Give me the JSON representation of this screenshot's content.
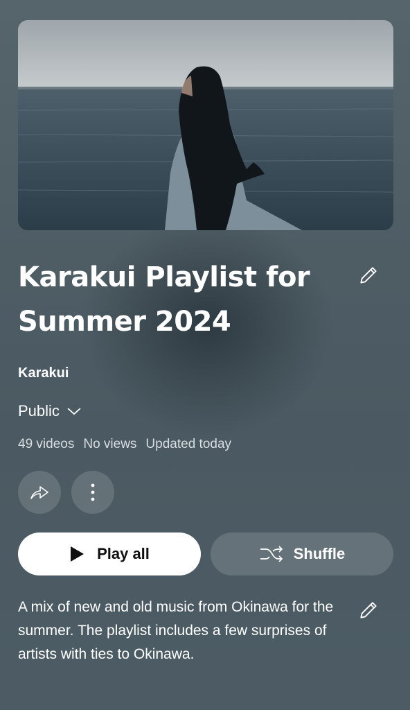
{
  "playlist": {
    "title": "Karakui Playlist for Summer 2024",
    "owner": "Karakui",
    "privacy": "Public",
    "stats": {
      "videos": "49 videos",
      "views": "No views",
      "updated": "Updated today"
    },
    "description": "A mix of new and old music from Okinawa for the summer. The playlist includes a few surprises of artists with ties to Okinawa."
  },
  "actions": {
    "play_all": "Play all",
    "shuffle": "Shuffle"
  },
  "icons": {
    "edit_title": "pencil-icon",
    "edit_description": "pencil-icon",
    "privacy_dropdown": "chevron-down-icon",
    "share": "share-icon",
    "more": "more-vertical-icon",
    "play": "play-icon",
    "shuffle": "shuffle-icon"
  },
  "colors": {
    "background": "#4f5d65",
    "play_button_bg": "#ffffff",
    "play_button_text": "#0f0f0f",
    "secondary_button_bg": "rgba(255,255,255,0.14)"
  }
}
